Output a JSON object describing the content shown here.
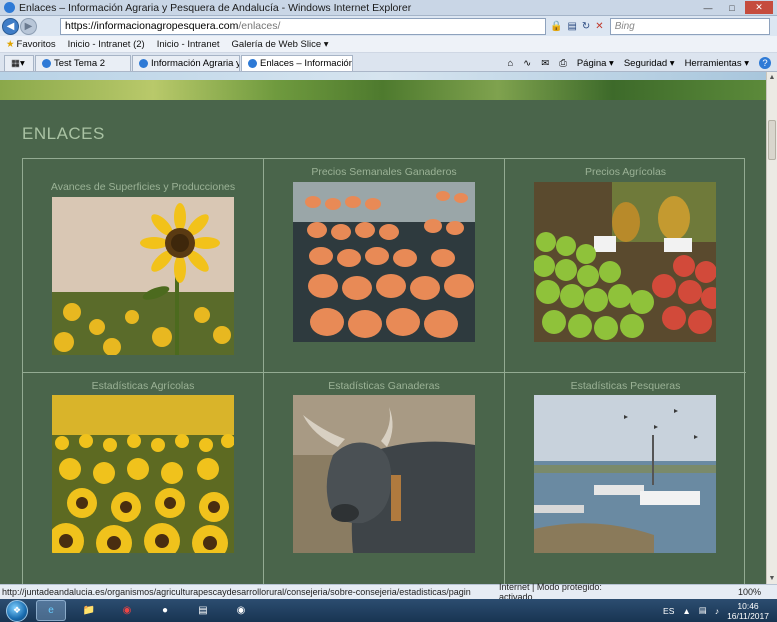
{
  "window": {
    "title": "Enlaces – Información Agraria y Pesquera de Andalucía - Windows Internet Explorer"
  },
  "address": {
    "host": "https://informacionagropesquera.com",
    "path": "/enlaces/",
    "search_placeholder": "Bing"
  },
  "favorites": {
    "label": "Favoritos",
    "items": [
      "Inicio - Intranet (2)",
      "Inicio - Intranet",
      "Galería de Web Slice ▾"
    ]
  },
  "tabs": [
    {
      "label": "Test Tema 2"
    },
    {
      "label": "Información Agraria y Pes..."
    },
    {
      "label": "Enlaces – Información ..."
    }
  ],
  "toolbar": {
    "pagina": "Página ▾",
    "seguridad": "Seguridad ▾",
    "herramientas": "Herramientas ▾",
    "help": "?"
  },
  "page": {
    "heading": "ENLACES",
    "links": [
      {
        "title": "Avances de Superficies y Producciones",
        "image": "sunflower-single"
      },
      {
        "title": "Precios Semanales Ganaderos",
        "image": "eggs"
      },
      {
        "title": "Precios Agrícolas",
        "image": "fruit-market"
      },
      {
        "title": "Estadísticas Agrícolas",
        "image": "sunflower-field"
      },
      {
        "title": "Estadísticas Ganaderas",
        "image": "bull"
      },
      {
        "title": "Estadísticas Pesqueras",
        "image": "fishing-boats"
      }
    ]
  },
  "status": {
    "url": "http://juntadeandalucia.es/organismos/agriculturapescaydesarrollorural/consejeria/sobre-consejeria/estadisticas/pagin",
    "zone": "Internet | Modo protegido: activado",
    "zoom": "100%"
  },
  "taskbar": {
    "lang": "ES",
    "time": "10:46",
    "date": "16/11/2017"
  },
  "colors": {
    "page_bg": "#4a654b",
    "grid_line": "#93ab92",
    "text_muted": "#9bb296"
  }
}
